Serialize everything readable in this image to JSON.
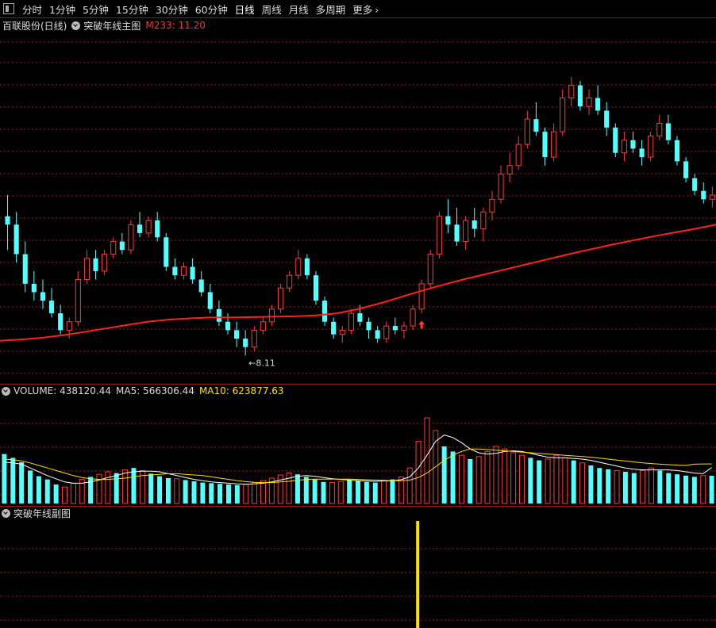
{
  "toolbar": {
    "periods": [
      "分时",
      "1分钟",
      "5分钟",
      "15分钟",
      "30分钟",
      "60分钟",
      "日线",
      "周线",
      "月线",
      "多周期",
      "更多"
    ],
    "active": "日线"
  },
  "main_panel": {
    "stock_name": "百联股份(日线)",
    "indicator_name": "突破年线主图",
    "ma_label": "M233: 11.20",
    "low_marker": "8.11"
  },
  "volume_panel": {
    "volume_label": "VOLUME: 438120.44",
    "ma5_label": "MA5: 566306.44",
    "ma10_label": "MA10: 623877.63"
  },
  "sub_panel": {
    "indicator_name": "突破年线副图"
  },
  "colors": {
    "up": "#ff3a3a",
    "down": "#54ffff",
    "ma233": "#ff2020",
    "ma10": "#ffe000",
    "ma5": "#ffffff",
    "signal": "#ffe000",
    "grid": "#a01818"
  },
  "chart_data": [
    {
      "type": "candlestick",
      "title": "突破年线主图",
      "series": [
        {
          "name": "M233",
          "values": [
            8.45,
            8.48,
            8.52,
            8.58,
            8.66,
            8.74,
            8.82,
            8.9,
            8.95,
            8.98,
            9.0,
            9.0,
            9.01,
            9.02,
            9.03,
            9.05,
            9.1,
            9.2,
            9.33,
            9.48,
            9.63,
            9.77,
            9.9,
            10.02,
            10.14,
            10.26,
            10.38,
            10.5,
            10.61,
            10.72,
            10.82,
            10.92,
            11.01,
            11.1,
            11.2
          ]
        }
      ],
      "candles": [
        [
          11.4,
          11.9,
          10.6,
          11.2
        ],
        [
          11.2,
          11.5,
          10.3,
          10.5
        ],
        [
          10.5,
          10.8,
          9.6,
          9.8
        ],
        [
          9.8,
          10.1,
          9.4,
          9.6
        ],
        [
          9.6,
          9.9,
          9.2,
          9.4
        ],
        [
          9.4,
          9.7,
          9.0,
          9.1
        ],
        [
          9.1,
          9.3,
          8.6,
          8.7
        ],
        [
          8.7,
          9.0,
          8.5,
          8.9
        ],
        [
          8.9,
          10.1,
          8.8,
          9.9
        ],
        [
          9.9,
          10.6,
          9.8,
          10.4
        ],
        [
          10.4,
          10.6,
          9.9,
          10.1
        ],
        [
          10.1,
          10.6,
          10.0,
          10.5
        ],
        [
          10.5,
          10.9,
          10.4,
          10.8
        ],
        [
          10.8,
          11.0,
          10.5,
          10.6
        ],
        [
          10.6,
          11.3,
          10.5,
          11.2
        ],
        [
          11.2,
          11.5,
          10.9,
          11.0
        ],
        [
          11.0,
          11.4,
          10.9,
          11.3
        ],
        [
          11.3,
          11.5,
          10.8,
          10.9
        ],
        [
          10.9,
          11.0,
          10.1,
          10.2
        ],
        [
          10.2,
          10.4,
          9.9,
          10.0
        ],
        [
          10.0,
          10.3,
          9.9,
          10.2
        ],
        [
          10.2,
          10.4,
          9.8,
          9.9
        ],
        [
          9.9,
          10.1,
          9.5,
          9.6
        ],
        [
          9.6,
          9.8,
          9.1,
          9.2
        ],
        [
          9.2,
          9.4,
          8.8,
          8.9
        ],
        [
          8.9,
          9.1,
          8.6,
          8.7
        ],
        [
          8.7,
          8.9,
          8.3,
          8.5
        ],
        [
          8.5,
          8.7,
          8.1,
          8.3
        ],
        [
          8.3,
          8.8,
          8.2,
          8.7
        ],
        [
          8.7,
          9.0,
          8.6,
          8.9
        ],
        [
          8.9,
          9.3,
          8.8,
          9.2
        ],
        [
          9.2,
          9.8,
          9.1,
          9.7
        ],
        [
          9.7,
          10.1,
          9.6,
          10.0
        ],
        [
          10.0,
          10.6,
          9.9,
          10.4
        ],
        [
          10.4,
          10.5,
          9.9,
          10.0
        ],
        [
          10.0,
          10.1,
          9.3,
          9.4
        ],
        [
          9.4,
          9.5,
          8.8,
          8.9
        ],
        [
          8.9,
          9.0,
          8.5,
          8.6
        ],
        [
          8.6,
          8.8,
          8.4,
          8.7
        ],
        [
          8.7,
          9.2,
          8.6,
          9.1
        ],
        [
          9.1,
          9.3,
          8.8,
          8.9
        ],
        [
          8.9,
          9.0,
          8.5,
          8.7
        ],
        [
          8.7,
          8.8,
          8.4,
          8.5
        ],
        [
          8.5,
          8.9,
          8.4,
          8.8
        ],
        [
          8.8,
          9.0,
          8.6,
          8.7
        ],
        [
          8.7,
          8.9,
          8.5,
          8.8
        ],
        [
          8.8,
          9.3,
          8.7,
          9.2
        ],
        [
          9.2,
          9.9,
          9.1,
          9.8
        ],
        [
          9.8,
          10.6,
          9.7,
          10.5
        ],
        [
          10.5,
          11.5,
          10.4,
          11.4
        ],
        [
          11.4,
          11.8,
          11.0,
          11.2
        ],
        [
          11.2,
          11.6,
          10.7,
          10.8
        ],
        [
          10.8,
          11.4,
          10.6,
          11.3
        ],
        [
          11.3,
          11.6,
          10.9,
          11.1
        ],
        [
          11.1,
          11.6,
          10.8,
          11.5
        ],
        [
          11.5,
          12.0,
          11.3,
          11.8
        ],
        [
          11.8,
          12.6,
          11.7,
          12.4
        ],
        [
          12.4,
          12.9,
          12.2,
          12.6
        ],
        [
          12.6,
          13.3,
          12.5,
          13.1
        ],
        [
          13.1,
          13.9,
          13.0,
          13.7
        ],
        [
          13.7,
          14.1,
          13.3,
          13.4
        ],
        [
          13.4,
          13.5,
          12.6,
          12.8
        ],
        [
          12.8,
          13.6,
          12.7,
          13.4
        ],
        [
          13.4,
          14.4,
          13.3,
          14.2
        ],
        [
          14.2,
          14.7,
          14.0,
          14.5
        ],
        [
          14.5,
          14.6,
          13.9,
          14.0
        ],
        [
          14.0,
          14.4,
          13.8,
          14.2
        ],
        [
          14.2,
          14.5,
          13.8,
          13.9
        ],
        [
          13.9,
          14.1,
          13.3,
          13.5
        ],
        [
          13.5,
          13.6,
          12.8,
          12.9
        ],
        [
          12.9,
          13.4,
          12.7,
          13.2
        ],
        [
          13.2,
          13.4,
          12.9,
          13.0
        ],
        [
          13.0,
          13.2,
          12.6,
          12.8
        ],
        [
          12.8,
          13.4,
          12.7,
          13.3
        ],
        [
          13.3,
          13.8,
          13.2,
          13.6
        ],
        [
          13.6,
          13.8,
          13.1,
          13.2
        ],
        [
          13.2,
          13.3,
          12.6,
          12.7
        ],
        [
          12.7,
          12.8,
          12.2,
          12.3
        ],
        [
          12.3,
          12.4,
          11.9,
          12.0
        ],
        [
          12.0,
          12.2,
          11.7,
          11.8
        ],
        [
          11.8,
          12.1,
          11.6,
          11.9
        ],
        [
          11.9,
          12.0,
          11.3,
          11.4
        ]
      ]
    },
    {
      "type": "bar",
      "title": "VOLUME",
      "series": [
        {
          "name": "VOLUME",
          "values": [
            780,
            720,
            650,
            520,
            430,
            380,
            300,
            260,
            320,
            380,
            420,
            460,
            500,
            480,
            530,
            560,
            520,
            470,
            430,
            400,
            390,
            370,
            350,
            330,
            320,
            310,
            300,
            290,
            300,
            330,
            360,
            400,
            450,
            480,
            460,
            420,
            380,
            340,
            330,
            350,
            370,
            360,
            340,
            330,
            360,
            380,
            420,
            560,
            980,
            1350,
            1150,
            900,
            820,
            760,
            700,
            740,
            820,
            900,
            860,
            800,
            760,
            720,
            680,
            700,
            760,
            720,
            680,
            640,
            600,
            560,
            540,
            520,
            500,
            480,
            520,
            560,
            520,
            480,
            460,
            440,
            420,
            440,
            438
          ]
        },
        {
          "name": "MA5",
          "values": [
            650,
            640,
            620,
            560,
            500,
            440,
            390,
            340,
            320,
            320,
            340,
            370,
            410,
            440,
            480,
            500,
            510,
            510,
            500,
            470,
            440,
            410,
            380,
            360,
            340,
            330,
            320,
            310,
            305,
            310,
            320,
            340,
            370,
            400,
            430,
            440,
            430,
            410,
            390,
            380,
            370,
            360,
            355,
            350,
            355,
            360,
            375,
            420,
            560,
            760,
            980,
            1080,
            1040,
            960,
            860,
            800,
            780,
            790,
            820,
            830,
            820,
            790,
            760,
            730,
            720,
            720,
            710,
            700,
            680,
            650,
            620,
            590,
            560,
            540,
            530,
            530,
            530,
            530,
            520,
            500,
            480,
            470,
            566
          ]
        },
        {
          "name": "MA10",
          "values": [
            700,
            690,
            670,
            640,
            600,
            560,
            520,
            480,
            440,
            410,
            390,
            380,
            380,
            390,
            400,
            420,
            440,
            450,
            460,
            470,
            470,
            460,
            450,
            440,
            420,
            400,
            380,
            360,
            345,
            335,
            330,
            330,
            340,
            350,
            365,
            380,
            385,
            385,
            385,
            385,
            385,
            380,
            375,
            370,
            365,
            360,
            360,
            370,
            410,
            480,
            580,
            680,
            760,
            820,
            860,
            860,
            850,
            840,
            830,
            820,
            810,
            800,
            790,
            780,
            770,
            760,
            750,
            740,
            730,
            715,
            700,
            685,
            670,
            655,
            640,
            630,
            620,
            612,
            605,
            600,
            620,
            624,
            624
          ]
        }
      ]
    },
    {
      "type": "bar",
      "title": "突破年线副图",
      "series": [
        {
          "name": "signal",
          "values": [
            0,
            0,
            0,
            0,
            0,
            0,
            0,
            0,
            0,
            0,
            0,
            0,
            0,
            0,
            0,
            0,
            0,
            0,
            0,
            0,
            0,
            0,
            0,
            0,
            0,
            0,
            0,
            0,
            0,
            0,
            0,
            0,
            0,
            0,
            0,
            0,
            0,
            0,
            0,
            0,
            0,
            0,
            0,
            0,
            0,
            0,
            0,
            1,
            0,
            0,
            0,
            0,
            0,
            0,
            0,
            0,
            0,
            0,
            0,
            0,
            0,
            0,
            0,
            0,
            0,
            0,
            0,
            0,
            0,
            0,
            0,
            0,
            0,
            0,
            0,
            0,
            0,
            0,
            0,
            0,
            0,
            0,
            0
          ]
        }
      ]
    }
  ]
}
